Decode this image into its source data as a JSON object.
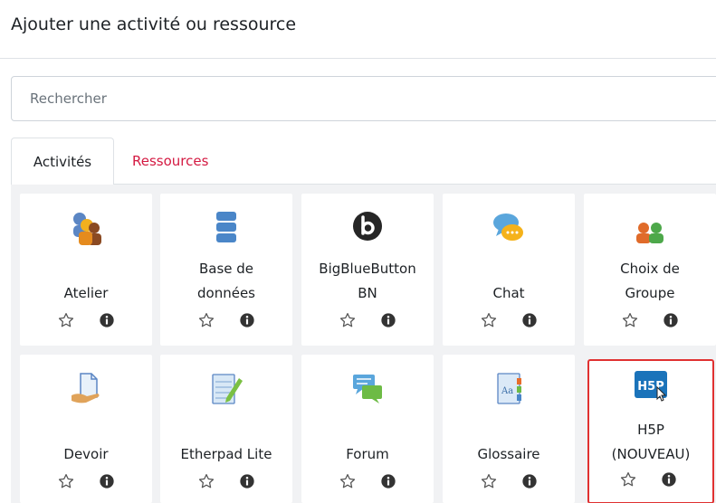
{
  "header": {
    "title": "Ajouter une activité ou ressource"
  },
  "search": {
    "placeholder": "Rechercher"
  },
  "tabs": [
    {
      "label": "Activités",
      "active": true
    },
    {
      "label": "Ressources",
      "active": false
    }
  ],
  "colors": {
    "accent": "#d41a42",
    "selection": "#e03131",
    "grid_bg": "#f1f2f4"
  },
  "cards": [
    {
      "name": "Atelier",
      "icon": "workshop-icon"
    },
    {
      "name1": "Base de",
      "name2": "données",
      "icon": "database-icon"
    },
    {
      "name1": "BigBlueButton",
      "name2": "BN",
      "icon": "bigbluebutton-icon"
    },
    {
      "name": "Chat",
      "icon": "chat-icon"
    },
    {
      "name1": "Choix de",
      "name2": "Groupe",
      "icon": "group-choice-icon"
    },
    {
      "name": "Devoir",
      "icon": "assignment-icon"
    },
    {
      "name": "Etherpad Lite",
      "icon": "etherpad-icon"
    },
    {
      "name": "Forum",
      "icon": "forum-icon"
    },
    {
      "name": "Glossaire",
      "icon": "glossary-icon"
    },
    {
      "name1": "H5P",
      "name2": "(NOUVEAU)",
      "icon": "h5p-icon",
      "icon_text": "H5P",
      "selected": true
    }
  ]
}
